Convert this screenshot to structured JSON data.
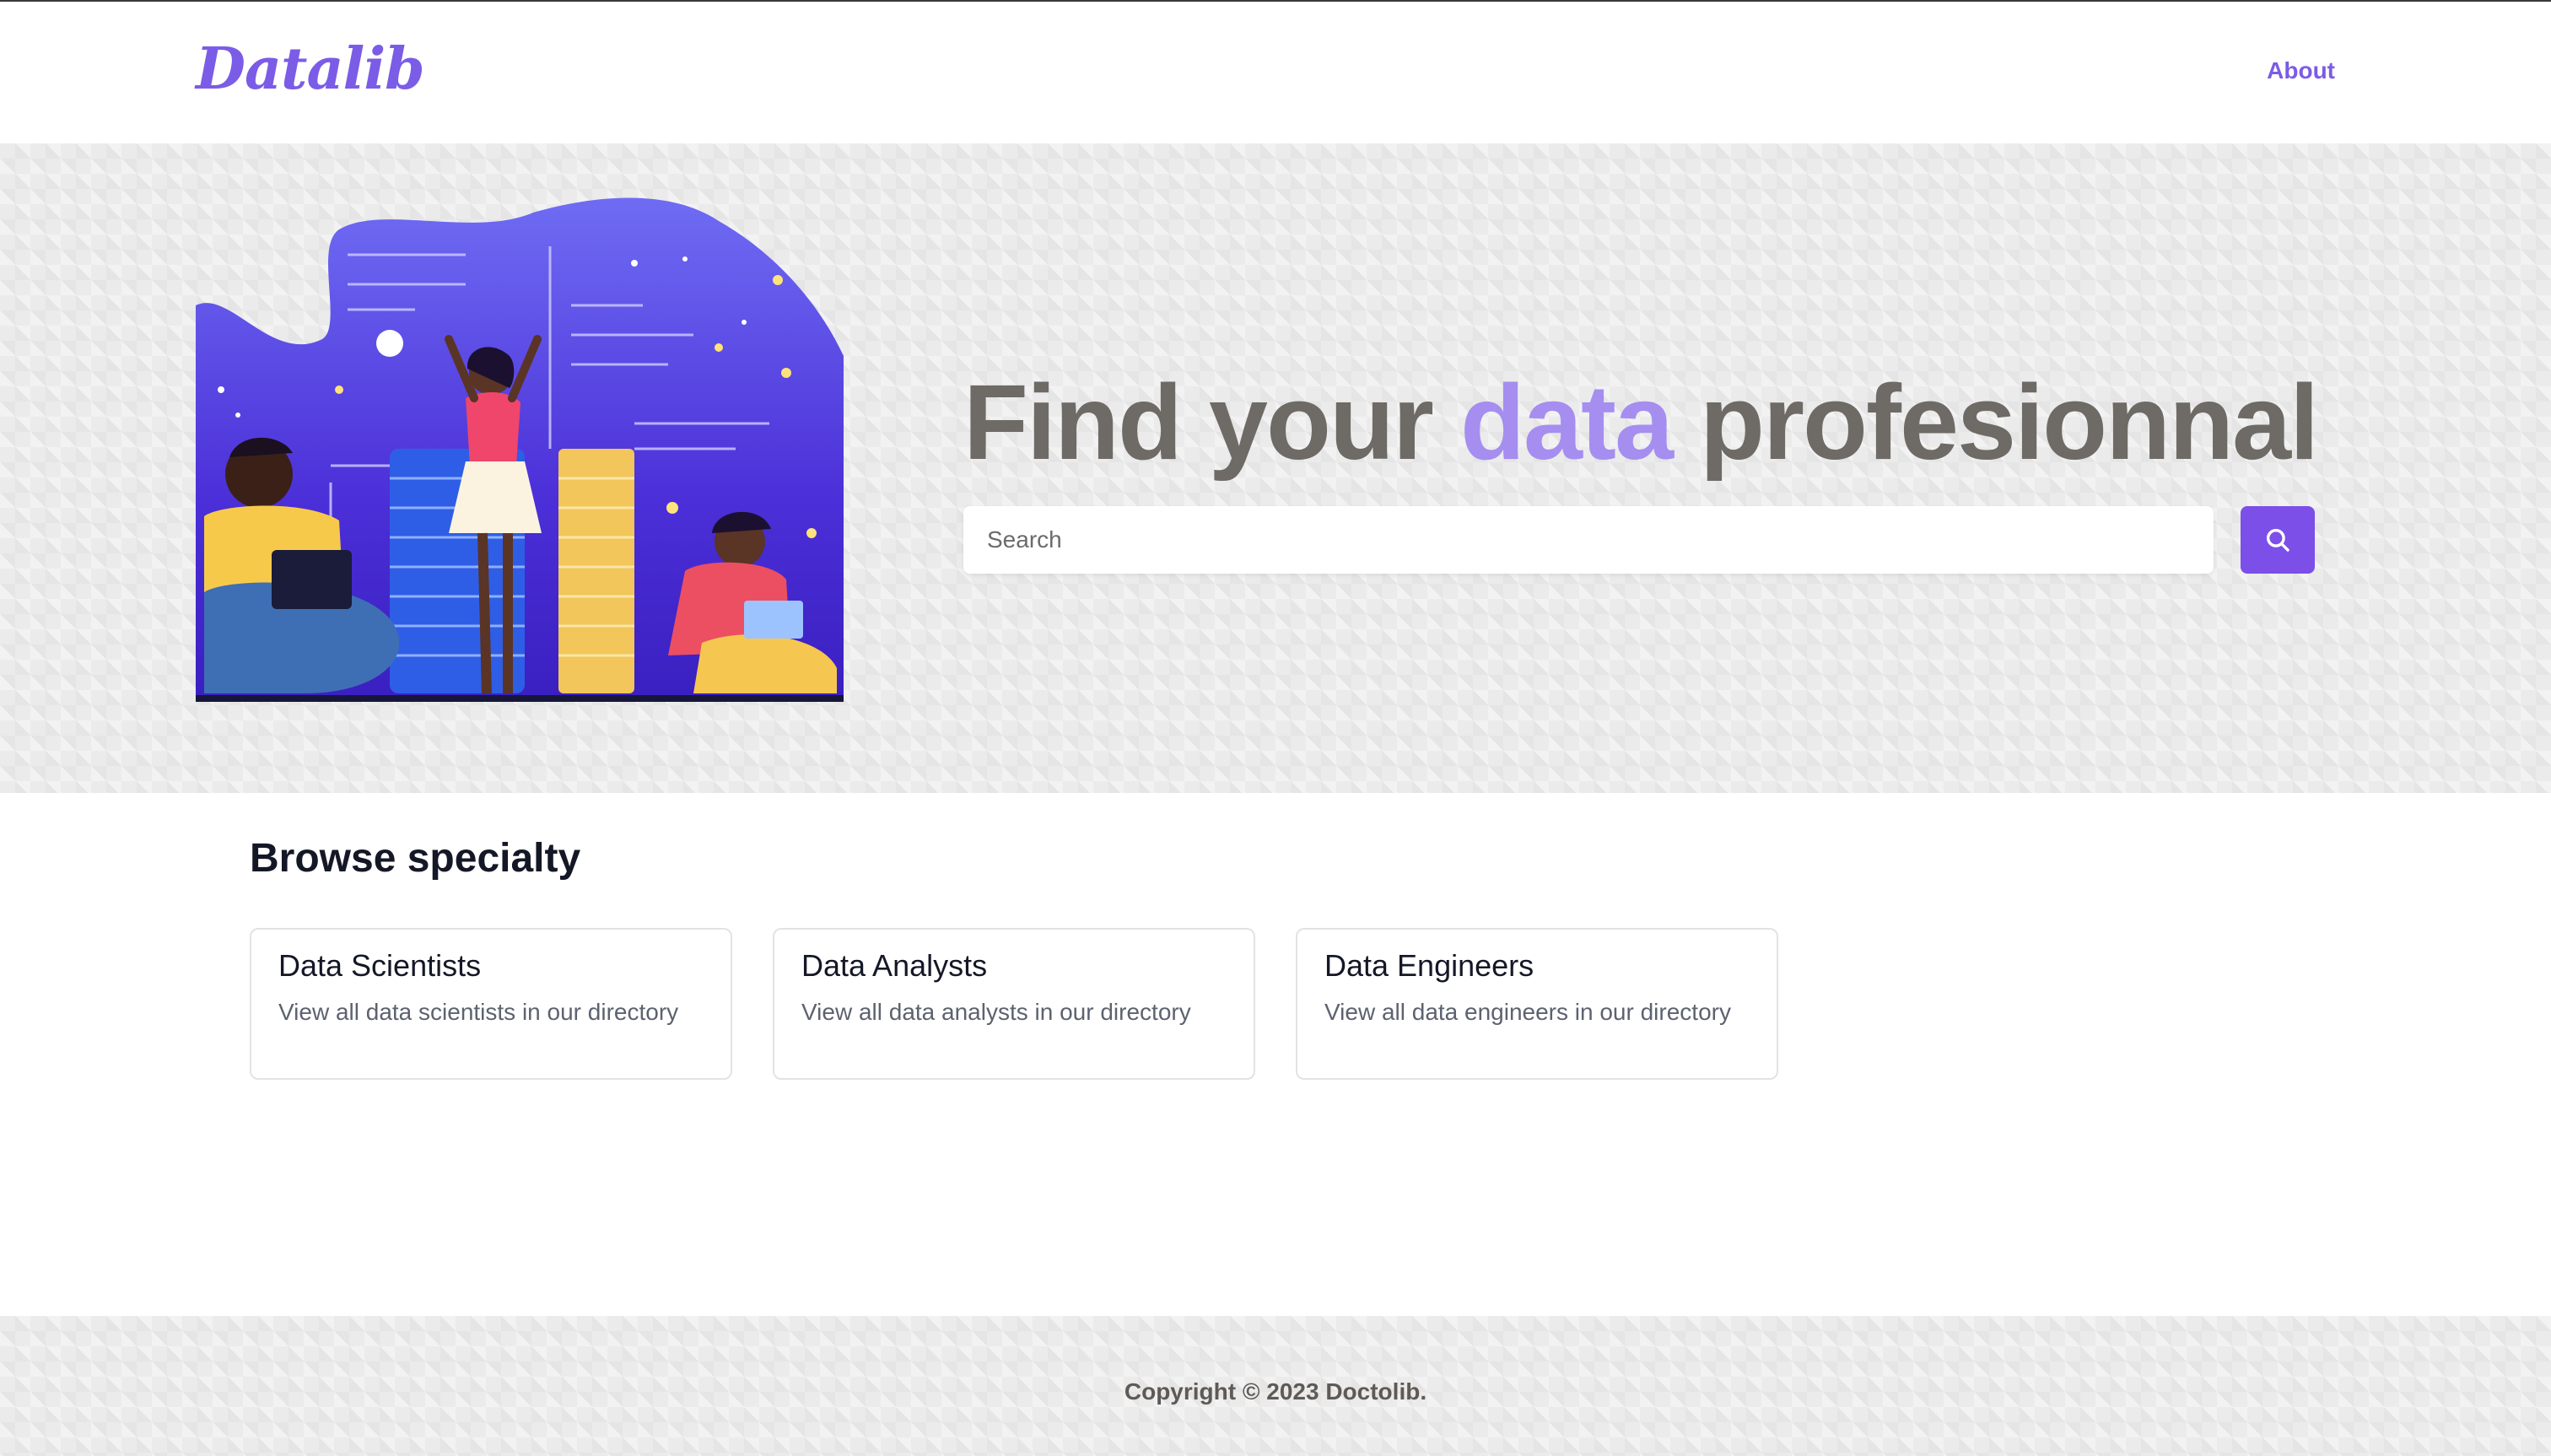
{
  "navbar": {
    "logo": "Datalib",
    "about_label": "About"
  },
  "hero": {
    "title_part1": "Find your ",
    "title_accent": "data",
    "title_part2": " profesionnal",
    "search_placeholder": "Search",
    "search_icon": "search-icon",
    "illustration": "data-people-illustration"
  },
  "browse": {
    "title": "Browse specialty",
    "cards": [
      {
        "title": "Data Scientists",
        "description": "View all data scientists in our directory"
      },
      {
        "title": "Data Analysts",
        "description": "View all data analysts in our directory"
      },
      {
        "title": "Data Engineers",
        "description": "View all data engineers in our directory"
      }
    ]
  },
  "footer": {
    "copyright": "Copyright © 2023 Doctolib."
  },
  "colors": {
    "brand": "#7b5ce6",
    "accent_light": "#a58ef0",
    "button": "#7b4fe8",
    "heading_gray": "#6e6a66"
  }
}
